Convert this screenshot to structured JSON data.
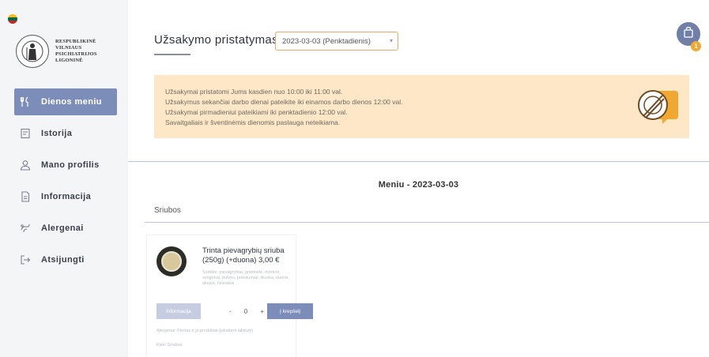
{
  "sidebar": {
    "logo_lines": [
      "RESPUBLIKINĖ",
      "VILNIAUS",
      "PSICHIATRIJOS",
      "LIGONINĖ"
    ],
    "items": [
      {
        "label": "Dienos meniu",
        "icon": "cutlery-icon",
        "active": true
      },
      {
        "label": "Istorija",
        "icon": "history-icon",
        "active": false
      },
      {
        "label": "Mano profilis",
        "icon": "user-icon",
        "active": false
      },
      {
        "label": "Informacija",
        "icon": "document-icon",
        "active": false
      },
      {
        "label": "Alergenai",
        "icon": "allergen-icon",
        "active": false
      },
      {
        "label": "Atsijungti",
        "icon": "logout-icon",
        "active": false
      }
    ]
  },
  "header": {
    "title": "Užsakymo pristatymas",
    "date_select_value": "2023-03-03 (Penktadienis)",
    "cart_count": "1"
  },
  "banner": {
    "lines": [
      "Užsakymai pristatomi Jums kasdien nuo 10:00 iki 11:00 val.",
      "Užsakymus sekančiai darbo dienai pateikite iki einamos darbo dienos 12:00 val.",
      "Užsakymai pirmadieniui pateikiami iki penktadienio 12:00 val.",
      "Savaitgaliais ir šventinėmis dienomis paslauga neteikiama."
    ]
  },
  "menu": {
    "heading": "Meniu - 2023-03-03",
    "category": "Sriubos",
    "products": [
      {
        "name": "Trinta pievagrybių sriuba (250g) (+duona)",
        "price": "3,00 €",
        "description": "Sudėtis: pievagrybiai, grietinėlė, morkos, svogūnai, bulvės, prieskoniai, druska, duona, aliejus, česnakai",
        "info_label": "Informacija",
        "quantity": "0",
        "add_label": "Į krepšelį",
        "allergen_note": "Alergenai: Pienas ir jo produktai (įskaitant laktozę)",
        "type_note": "Kiek: Sriubos"
      }
    ]
  },
  "colors": {
    "accent": "#7b8db8",
    "banner_bg": "#fde7c6",
    "badge": "#f0a830",
    "select_border": "#e8a96b"
  }
}
